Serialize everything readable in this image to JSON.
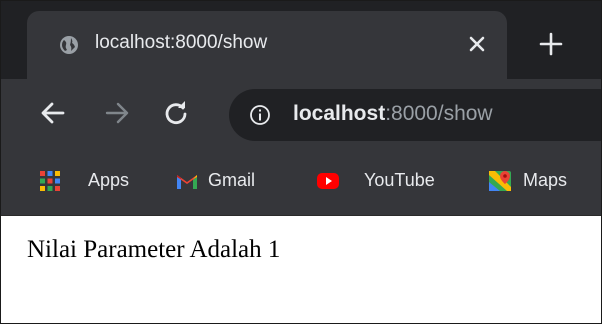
{
  "browser": {
    "tab": {
      "title": "localhost:8000/show",
      "favicon": "globe-icon",
      "close_icon": "close-icon"
    },
    "new_tab_icon": "plus-icon",
    "toolbar": {
      "back_icon": "arrow-left-icon",
      "forward_icon": "arrow-right-icon",
      "reload_icon": "reload-icon",
      "info_icon": "info-icon",
      "url_host": "localhost",
      "url_rest": ":8000/show"
    },
    "bookmarks": [
      {
        "label": "Apps",
        "icon": "apps-grid-icon"
      },
      {
        "label": "Gmail",
        "icon": "gmail-icon"
      },
      {
        "label": "YouTube",
        "icon": "youtube-icon"
      },
      {
        "label": "Maps",
        "icon": "maps-icon"
      }
    ],
    "colors": {
      "tabstrip_bg": "#202124",
      "toolbar_bg": "#35363a",
      "omnibox_bg": "#202124",
      "text_primary": "#e8eaed",
      "text_secondary": "#9aa0a6"
    }
  },
  "page": {
    "text": "Nilai Parameter Adalah 1"
  }
}
